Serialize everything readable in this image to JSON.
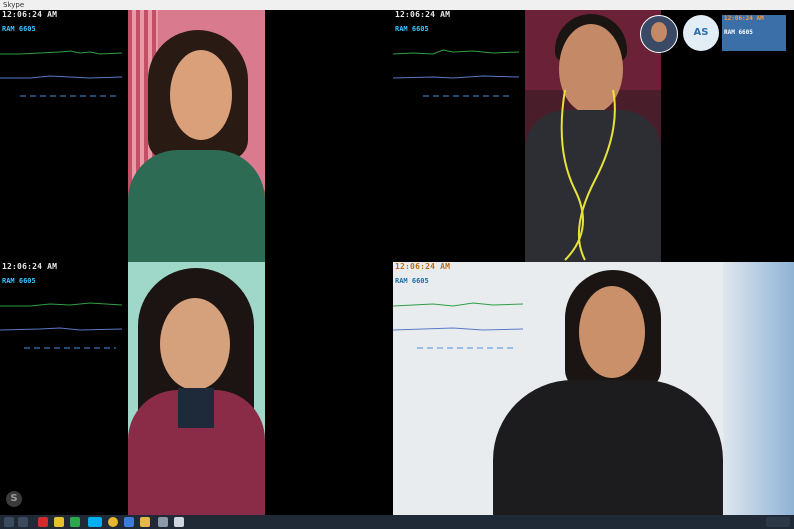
{
  "window": {
    "title": "Skype"
  },
  "tiles": [
    {
      "clock": "12:06:24 AM",
      "ram": "RAM 6605"
    },
    {
      "clock": "12:06:24 AM",
      "ram": "RAM 6605"
    },
    {
      "clock": "12:06:24 AM",
      "ram": "RAM 6605"
    },
    {
      "clock": "12:06:24 AM",
      "ram": "RAM 6605"
    }
  ],
  "participants": {
    "pip_initials": "AS",
    "pip_clock": "12:06:24 AM",
    "pip_ram": "RAM 6605"
  },
  "logo": {
    "glyph": "S"
  },
  "colors": {
    "skype_blue": "#00aff0",
    "taskbar": "#1f2a36"
  }
}
